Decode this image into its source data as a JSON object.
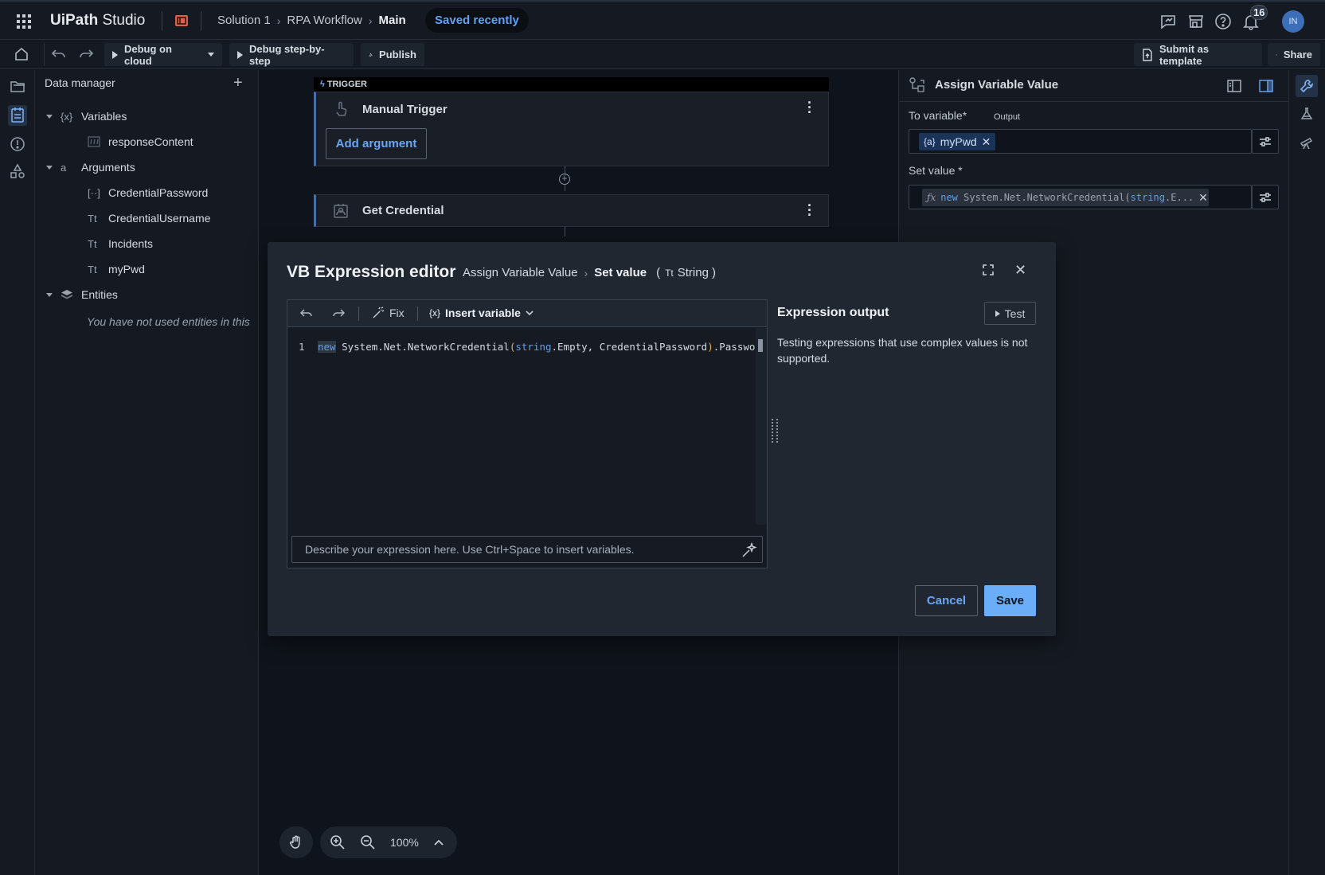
{
  "topbar": {
    "brand_main": "UiPath",
    "brand_sub": "Studio",
    "breadcrumbs": [
      "Solution 1",
      "RPA Workflow",
      "Main"
    ],
    "saved_status": "Saved recently",
    "notification_count": "16",
    "avatar_initials": "IN",
    "icons": [
      "apps-grid-icon",
      "project-icon",
      "feedback-icon",
      "marketplace-icon",
      "help-icon",
      "bell-icon"
    ]
  },
  "toolbar": {
    "debug_cloud": "Debug on cloud",
    "debug_step": "Debug step-by-step",
    "publish": "Publish",
    "submit_template": "Submit as template",
    "share": "Share"
  },
  "data_manager": {
    "title": "Data manager",
    "variables": {
      "label": "Variables",
      "token": "{x}",
      "items": [
        {
          "token": "",
          "label": "responseContent"
        }
      ]
    },
    "arguments": {
      "label": "Arguments",
      "token": "a",
      "items": [
        {
          "token": "[··]",
          "label": "CredentialPassword"
        },
        {
          "token": "Tt",
          "label": "CredentialUsername"
        },
        {
          "token": "Tt",
          "label": "Incidents"
        },
        {
          "token": "Tt",
          "label": "myPwd"
        }
      ]
    },
    "entities": {
      "label": "Entities",
      "empty_text": "You have not used entities in this"
    }
  },
  "canvas": {
    "trigger_tag": "TRIGGER",
    "manual_trigger": "Manual Trigger",
    "add_argument": "Add argument",
    "get_credential": "Get Credential",
    "zoom_level": "100%"
  },
  "props": {
    "title": "Assign Variable Value",
    "to_variable_label": "To variable*",
    "output_tag": "Output",
    "to_variable_chip": "myPwd",
    "chip_token": "{a}",
    "set_value_label": "Set value *",
    "set_value_kw": "new",
    "set_value_mid": " System.Net.NetworkCredential(",
    "set_value_kw2": "string",
    "set_value_tail": ".E..."
  },
  "modal": {
    "title": "VB Expression editor",
    "crumb_parent": "Assign Variable Value",
    "crumb_current": "Set value",
    "type_open": "(",
    "type_token": "Tt",
    "type_name": "String",
    "type_close": ")",
    "fix": "Fix",
    "insert_variable": "Insert variable",
    "insert_token": "{x}",
    "line_number": "1",
    "code": {
      "kw_new": "new",
      "part1": " System.Net.NetworkCredential",
      "paren_open": "(",
      "kw_string": "string",
      "part2": ".Empty, CredentialPassword",
      "paren_close": ")",
      "part3": ".Password"
    },
    "describe_placeholder": "Describe your expression here. Use Ctrl+Space to insert variables.",
    "output_title": "Expression output",
    "test": "Test",
    "output_message": "Testing expressions that use complex values is not supported.",
    "cancel": "Cancel",
    "save": "Save"
  }
}
